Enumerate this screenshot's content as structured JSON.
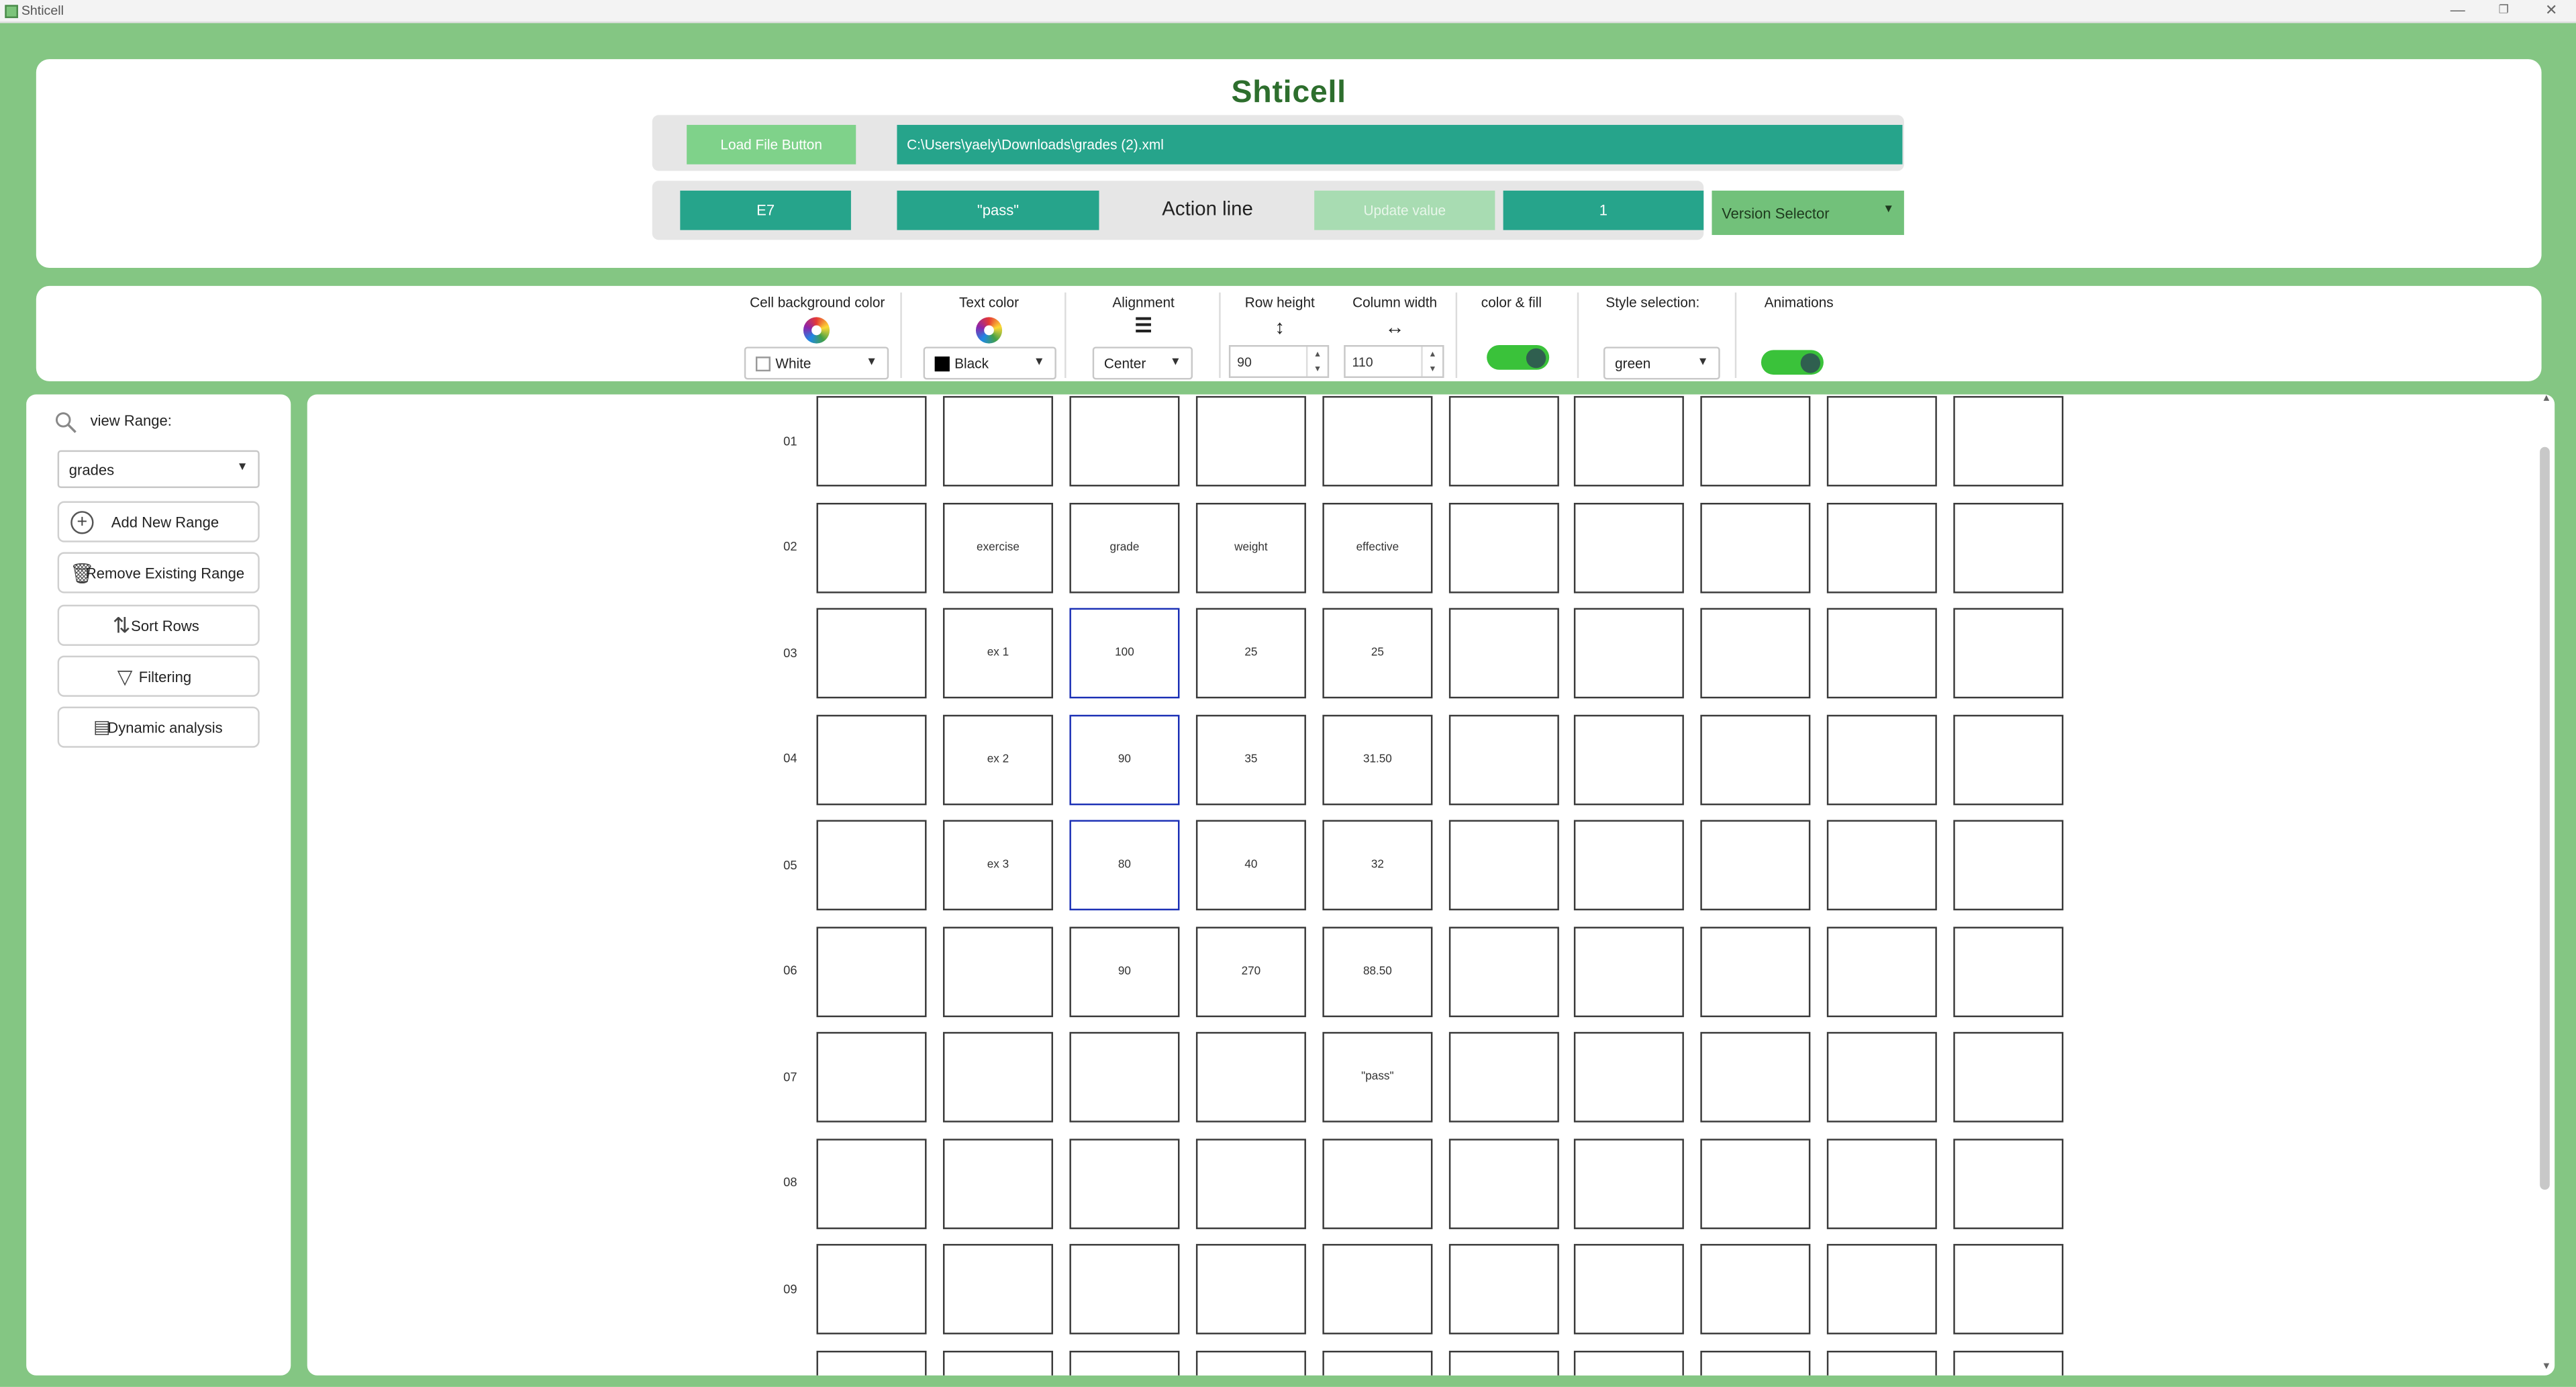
{
  "window": {
    "title": "Shticell",
    "minimize": "—",
    "maximize": "❐",
    "close": "✕"
  },
  "header": {
    "app_title": "Shticell",
    "load_button": "Load File Button",
    "file_path": "C:\\Users\\yaely\\Downloads\\grades (2).xml",
    "cell_id": "E7",
    "cell_value": "\"pass\"",
    "action_line": "Action line",
    "update_button": "Update value",
    "version_number": "1",
    "version_selector": "Version Selector"
  },
  "toolbar": {
    "cell_bg": {
      "label": "Cell background color",
      "value": "White"
    },
    "text_color": {
      "label": "Text color",
      "value": "Black"
    },
    "alignment": {
      "label": "Alignment",
      "value": "Center"
    },
    "row_height": {
      "label": "Row height",
      "value": "90"
    },
    "column_width": {
      "label": "Column width",
      "value": "110"
    },
    "color_fill": {
      "label": "color & fill",
      "enabled": true
    },
    "style": {
      "label": "Style selection:",
      "value": "green"
    },
    "animations": {
      "label": "Animations",
      "enabled": true
    }
  },
  "sidebar": {
    "view_range_label": "view Range:",
    "range_select": "grades",
    "buttons": {
      "add": "Add New Range",
      "remove": "Remove Existing Range",
      "sort": "Sort Rows",
      "filter": "Filtering",
      "dynamic": "Dynamic analysis"
    }
  },
  "grid": {
    "row_labels": [
      "01",
      "02",
      "03",
      "04",
      "05",
      "06",
      "07",
      "08",
      "09"
    ],
    "rows": [
      [
        "",
        "",
        "",
        "",
        "",
        "",
        "",
        "",
        "",
        ""
      ],
      [
        "",
        "exercise",
        "grade",
        "weight",
        "effective",
        "",
        "",
        "",
        "",
        ""
      ],
      [
        "",
        "ex 1",
        "100",
        "25",
        "25",
        "",
        "",
        "",
        "",
        ""
      ],
      [
        "",
        "ex 2",
        "90",
        "35",
        "31.50",
        "",
        "",
        "",
        "",
        ""
      ],
      [
        "",
        "ex 3",
        "80",
        "40",
        "32",
        "",
        "",
        "",
        "",
        ""
      ],
      [
        "",
        "",
        "90",
        "270",
        "88.50",
        "",
        "",
        "",
        "",
        ""
      ],
      [
        "",
        "",
        "",
        "",
        "\"pass\"",
        "",
        "",
        "",
        "",
        ""
      ],
      [
        "",
        "",
        "",
        "",
        "",
        "",
        "",
        "",
        "",
        ""
      ],
      [
        "",
        "",
        "",
        "",
        "",
        "",
        "",
        "",
        "",
        ""
      ]
    ],
    "highlighted_cells": [
      "C3",
      "C4",
      "C5"
    ],
    "highlight_color": "#1a2fb5"
  },
  "colors": {
    "frame_green": "#84c683",
    "teal": "#26a48b",
    "title_green": "#2d6e2d",
    "toggle_green": "#3ac23a"
  }
}
